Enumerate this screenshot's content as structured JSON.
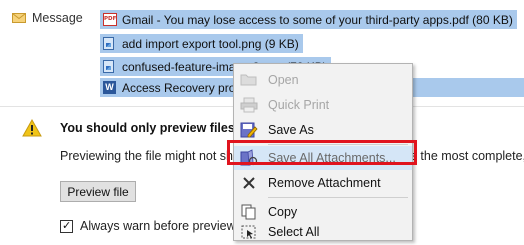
{
  "message": {
    "label": "Message",
    "attachments": [
      {
        "name": "Gmail - You may lose access to some of your third-party apps.pdf (80 KB)",
        "icon": "pdf-file-icon"
      },
      {
        "name": "add import export tool.png (9 KB)",
        "icon": "image-file-icon"
      },
      {
        "name": "confused-feature-image-3.png (72 KB)",
        "icon": "image-file-icon"
      },
      {
        "name": "Access Recovery produ",
        "icon": "word-file-icon"
      }
    ]
  },
  "warning": {
    "title": "You should only preview files fro",
    "body_left": "Previewing the file might not sho",
    "body_right": "e the most complete,",
    "preview_button": "Preview file",
    "checkbox_label": "Always warn before previewin",
    "checkbox_checked": true
  },
  "context_menu": {
    "items": [
      {
        "label": "Open",
        "enabled": false,
        "icon": "open-folder-icon"
      },
      {
        "label": "Quick Print",
        "enabled": false,
        "icon": "printer-icon"
      },
      {
        "label": "Save As",
        "enabled": true,
        "icon": "save-as-icon"
      },
      {
        "label": "Save All Attachments...",
        "enabled": true,
        "highlighted": true,
        "icon": "save-all-icon"
      },
      {
        "label": "Remove Attachment",
        "enabled": true,
        "icon": "remove-x-icon"
      },
      {
        "label": "Copy",
        "enabled": true,
        "icon": "copy-icon"
      },
      {
        "label": "Select All",
        "enabled": true,
        "icon": "select-all-icon"
      }
    ]
  },
  "colors": {
    "attachment_highlight": "#a9c9ec",
    "menu_highlight": "#d5e6f7",
    "callout_border": "#e0141e",
    "warning_yellow": "#f0c419"
  }
}
